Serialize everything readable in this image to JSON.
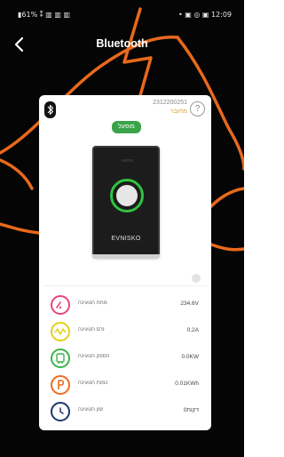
{
  "statusbar": {
    "left": "▮61% ⁑ ▥ ▥ ▥",
    "right": "• ▣ ◎ ▣ 12:09"
  },
  "header": {
    "title": "Bluetooth",
    "back_icon": "chevron-left-icon"
  },
  "card": {
    "serial": "2312200251",
    "status_text": "מחובר",
    "help_symbol": "?",
    "on_label": "מופעל",
    "device_brand": "EVNISKO"
  },
  "metrics": [
    {
      "label": "מתח הטעינה",
      "value": "234.6V",
      "icon": "gauge-icon",
      "color": "#e8457a"
    },
    {
      "label": "זרם הטעינה",
      "value": "0.2A",
      "icon": "wave-icon",
      "color": "#e3d11c"
    },
    {
      "label": "הספק הטעינה",
      "value": "0.0KW",
      "icon": "plug-icon",
      "color": "#3bb34a"
    },
    {
      "label": "כמות הטעינה",
      "value": "0.01KWh",
      "icon": "parking-icon",
      "color": "#ef6a1e"
    },
    {
      "label": "זמן הטעינה",
      "value": "דקות0",
      "icon": "clock-icon",
      "color": "#1b3a6b"
    }
  ],
  "colors": {
    "background": "#050505",
    "accent_orange": "#e8691c",
    "on_green": "#3aa34a"
  }
}
